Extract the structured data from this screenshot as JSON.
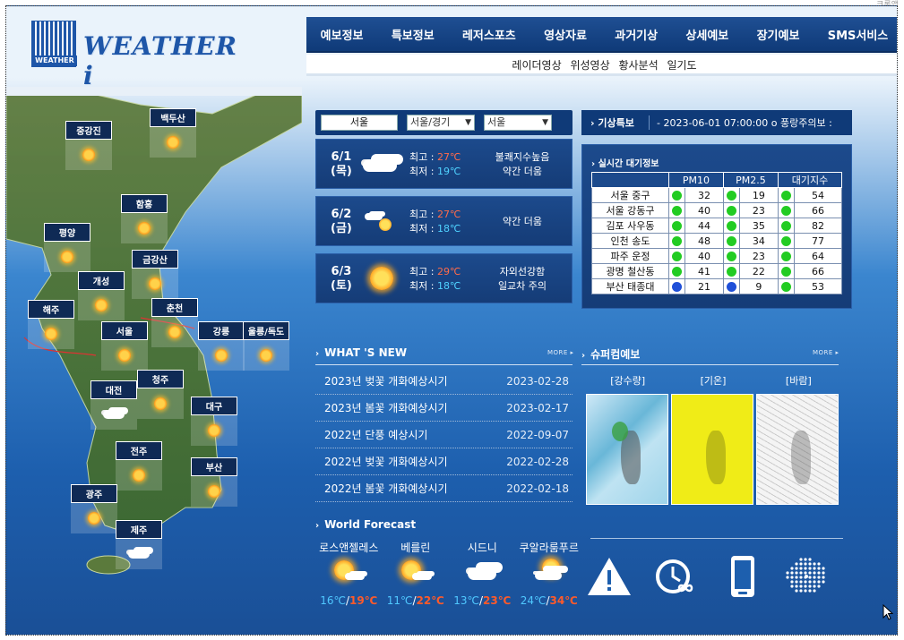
{
  "corner_text": "크롬앱",
  "logo": {
    "box_text": "WEATHER",
    "word": "WEATHER i"
  },
  "nav": [
    "예보정보",
    "특보정보",
    "레저스포츠",
    "영상자료",
    "과거기상",
    "상세예보",
    "장기예보",
    "SMS서비스"
  ],
  "subnav": [
    "레이더영상",
    "위성영상",
    "황사분석",
    "일기도"
  ],
  "map_regions": [
    {
      "name": "중강진",
      "icon": "sun"
    },
    {
      "name": "백두산",
      "icon": "sun"
    },
    {
      "name": "함흥",
      "icon": "sun"
    },
    {
      "name": "평양",
      "icon": "sun"
    },
    {
      "name": "금강산",
      "icon": "sun"
    },
    {
      "name": "개성",
      "icon": "sun"
    },
    {
      "name": "해주",
      "icon": "sun"
    },
    {
      "name": "춘천",
      "icon": "sun"
    },
    {
      "name": "서울",
      "icon": "sun"
    },
    {
      "name": "강릉",
      "icon": "sun"
    },
    {
      "name": "울릉/독도",
      "icon": "sun"
    },
    {
      "name": "청주",
      "icon": "sun"
    },
    {
      "name": "대전",
      "icon": "cloud"
    },
    {
      "name": "대구",
      "icon": "sun"
    },
    {
      "name": "전주",
      "icon": "sun"
    },
    {
      "name": "부산",
      "icon": "sun"
    },
    {
      "name": "광주",
      "icon": "sun"
    },
    {
      "name": "제주",
      "icon": "cloud"
    }
  ],
  "search": {
    "city": "서울",
    "province": "서울/경기",
    "district": "서울"
  },
  "daily": [
    {
      "date": "6/1",
      "day": "(목)",
      "icon": "cloud",
      "hi_label": "최고 : ",
      "hi": "27℃",
      "lo_label": "최저 : ",
      "lo": "19℃",
      "desc1": "불쾌지수높음",
      "desc2": "약간 더움"
    },
    {
      "date": "6/2",
      "day": "(금)",
      "icon": "sun-cloud",
      "hi_label": "최고 : ",
      "hi": "27℃",
      "lo_label": "최저 : ",
      "lo": "18℃",
      "desc1": "약간 더움",
      "desc2": ""
    },
    {
      "date": "6/3",
      "day": "(토)",
      "icon": "sun",
      "hi_label": "최고 : ",
      "hi": "29℃",
      "lo_label": "최저 : ",
      "lo": "18℃",
      "desc1": "자외선강함",
      "desc2": "일교차 주의"
    }
  ],
  "alert": {
    "label": "기상특보",
    "text": "- 2023-06-01 07:00:00 o 풍랑주의보 :"
  },
  "air": {
    "title": "실시간 대기정보",
    "headers": [
      "",
      "PM10",
      "PM2.5",
      "대기지수"
    ],
    "rows": [
      {
        "loc": "서울 중구",
        "pm10": "32",
        "pm10_c": "#22cc22",
        "pm25": "19",
        "pm25_c": "#22cc22",
        "idx": "54",
        "idx_c": "#22cc22"
      },
      {
        "loc": "서울 강동구",
        "pm10": "40",
        "pm10_c": "#22cc22",
        "pm25": "23",
        "pm25_c": "#22cc22",
        "idx": "66",
        "idx_c": "#22cc22"
      },
      {
        "loc": "김포 사우동",
        "pm10": "44",
        "pm10_c": "#22cc22",
        "pm25": "35",
        "pm25_c": "#22cc22",
        "idx": "82",
        "idx_c": "#22cc22"
      },
      {
        "loc": "인천 송도",
        "pm10": "48",
        "pm10_c": "#22cc22",
        "pm25": "34",
        "pm25_c": "#22cc22",
        "idx": "77",
        "idx_c": "#22cc22"
      },
      {
        "loc": "파주 운정",
        "pm10": "40",
        "pm10_c": "#22cc22",
        "pm25": "23",
        "pm25_c": "#22cc22",
        "idx": "64",
        "idx_c": "#22cc22"
      },
      {
        "loc": "광명 철산동",
        "pm10": "41",
        "pm10_c": "#22cc22",
        "pm25": "22",
        "pm25_c": "#22cc22",
        "idx": "66",
        "idx_c": "#22cc22"
      },
      {
        "loc": "부산 태종대",
        "pm10": "21",
        "pm10_c": "#1f4fd8",
        "pm25": "9",
        "pm25_c": "#1f4fd8",
        "idx": "53",
        "idx_c": "#22cc22"
      }
    ]
  },
  "news": {
    "title": "WHAT 'S NEW",
    "more": "MORE ▸",
    "items": [
      {
        "title": "2023년 벚꽃 개화예상시기",
        "date": "2023-02-28"
      },
      {
        "title": "2023년 봄꽃 개화예상시기",
        "date": "2023-02-17"
      },
      {
        "title": "2022년 단풍 예상시기",
        "date": "2022-09-07"
      },
      {
        "title": "2022년 벚꽃 개화예상시기",
        "date": "2022-02-28"
      },
      {
        "title": "2022년 봄꽃 개화예상시기",
        "date": "2022-02-18"
      }
    ]
  },
  "super": {
    "title": "슈퍼컴예보",
    "more": "MORE ▸",
    "labels": [
      "[강수량]",
      "[기온]",
      "[바람]"
    ]
  },
  "world": {
    "title": "World Forecast",
    "cities": [
      {
        "name": "로스앤젤레스",
        "icon": "sun-cloud",
        "lo": "16℃",
        "hi": "19℃"
      },
      {
        "name": "베를린",
        "icon": "sun-cloud",
        "lo": "11℃",
        "hi": "22℃"
      },
      {
        "name": "시드니",
        "icon": "cloud",
        "lo": "13℃",
        "hi": "23℃"
      },
      {
        "name": "쿠알라룸푸르",
        "icon": "sun-cloud",
        "lo": "24℃",
        "hi": "34℃"
      }
    ],
    "sep": "/"
  },
  "bottom_icons": [
    "warning-icon",
    "clock-infinity-icon",
    "mobile-phone-icon",
    "dot-globe-icon"
  ]
}
